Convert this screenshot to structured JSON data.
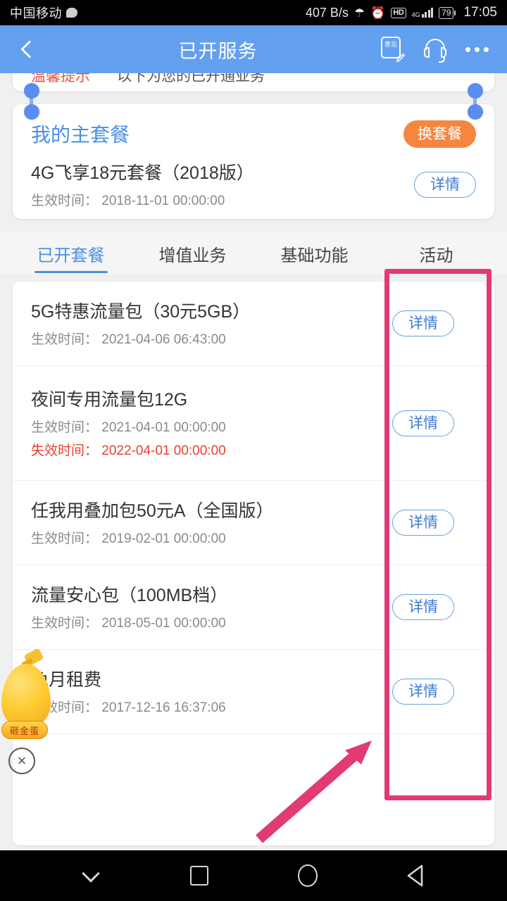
{
  "status_bar": {
    "carrier": "中国移动",
    "net_speed": "407 B/s",
    "bluetooth_icon": "bluetooth-icon",
    "alarm_icon": "alarm-icon",
    "hd_label": "HD",
    "network_type": "4G",
    "battery_level": "79",
    "time": "17:05"
  },
  "app_bar": {
    "title": "已开服务",
    "back_icon": "back-arrow-icon",
    "feedback_label": "意见",
    "feedback_icon": "feedback-note-icon",
    "headset_icon": "headset-icon",
    "more_icon": "more-dots-icon"
  },
  "cut_card": {
    "red_text": "温馨提示",
    "gray_text": "以下为您的已开通业务"
  },
  "main_package": {
    "section_title": "我的主套餐",
    "change_button": "换套餐",
    "name": "4G飞享18元套餐（2018版）",
    "effective_label": "生效时间：",
    "effective_time": "2018-11-01  00:00:00",
    "detail_button": "详情"
  },
  "tabs": [
    {
      "label": "已开套餐",
      "active": true
    },
    {
      "label": "增值业务",
      "active": false
    },
    {
      "label": "基础功能",
      "active": false
    },
    {
      "label": "活动",
      "active": false
    }
  ],
  "labels": {
    "effective": "生效时间：",
    "expire": "失效时间：",
    "detail": "详情"
  },
  "service_list": [
    {
      "name": "5G特惠流量包（30元5GB）",
      "effective_label": "生效时间：",
      "effective_time": "2021-04-06  06:43:00",
      "expire_label": "",
      "expire_time": "",
      "detail_button": "详情"
    },
    {
      "name": "夜间专用流量包12G",
      "effective_label": "生效时间：",
      "effective_time": "2021-04-01  00:00:00",
      "expire_label": "失效时间：",
      "expire_time": "2022-04-01  00:00:00",
      "detail_button": "详情"
    },
    {
      "name": "任我用叠加包50元A（全国版）",
      "effective_label": "生效时间：",
      "effective_time": "2019-02-01  00:00:00",
      "expire_label": "",
      "expire_time": "",
      "detail_button": "详情"
    },
    {
      "name": "流量安心包（100MB档）",
      "effective_label": "生效时间：",
      "effective_time": "2018-05-01  00:00:00",
      "expire_label": "",
      "expire_time": "",
      "detail_button": "详情"
    },
    {
      "name": "免月租费",
      "effective_label": "生效时间：",
      "effective_time": "2017-12-16  16:37:06",
      "expire_label": "",
      "expire_time": "",
      "detail_button": "详情"
    }
  ],
  "floating_ad": {
    "label": "砸金蛋",
    "egg_icon": "gold-egg-icon",
    "hammer_icon": "hammer-icon",
    "close_icon": "×"
  },
  "annotation": {
    "box_color": "#e13a74",
    "arrow_color": "#e13a74"
  },
  "nav_bar": {
    "hide_icon": "chevron-down-icon",
    "recents_icon": "square-recents-icon",
    "home_icon": "circle-home-icon",
    "back_icon": "triangle-back-icon"
  },
  "colors": {
    "appbar": "#63a0ef",
    "accent_blue": "#4a90e2",
    "orange": "#f5863f",
    "red": "#e8402e",
    "pink": "#e13a74"
  }
}
